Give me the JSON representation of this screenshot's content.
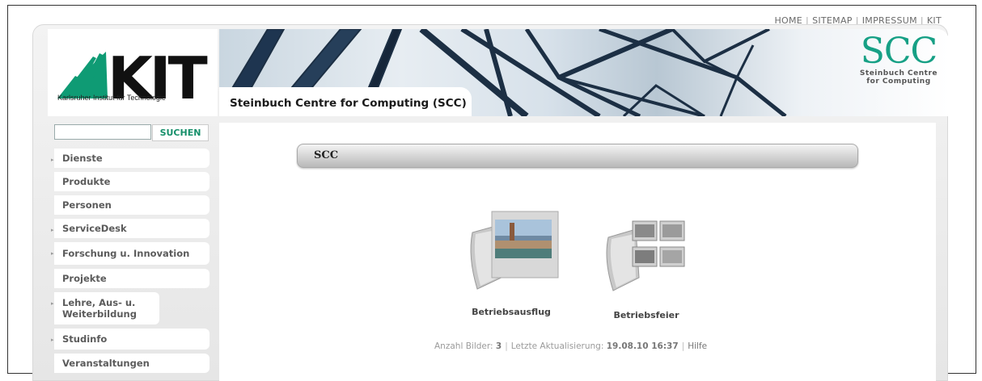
{
  "topnav": {
    "items": [
      "HOME",
      "SITEMAP",
      "IMPRESSUM",
      "KIT"
    ]
  },
  "header": {
    "kit_logo_text": "KIT",
    "kit_subtitle": "Karlsruher Institut für Technologie",
    "banner_title": "Steinbuch Centre for Computing (SCC)",
    "scc_logo_letters": "SCC",
    "scc_logo_line1": "Steinbuch Centre",
    "scc_logo_line2": "for Computing"
  },
  "search": {
    "value": "",
    "button_label": "SUCHEN"
  },
  "sidebar": {
    "items": [
      {
        "label": "Dienste",
        "arrow": true
      },
      {
        "label": "Produkte",
        "arrow": false
      },
      {
        "label": "Personen",
        "arrow": false
      },
      {
        "label": "ServiceDesk",
        "arrow": true
      },
      {
        "label": "Forschung u. Innovation",
        "arrow": true
      },
      {
        "label": "Projekte",
        "arrow": false
      },
      {
        "label": "Lehre, Aus- u. Weiterbildung",
        "arrow": true
      },
      {
        "label": "Studinfo",
        "arrow": true
      },
      {
        "label": "Veranstaltungen",
        "arrow": false
      }
    ]
  },
  "main": {
    "section_title": "SCC",
    "albums": [
      {
        "label": "Betriebsausflug"
      },
      {
        "label": "Betriebsfeier"
      }
    ],
    "footer": {
      "count_label": "Anzahl Bilder:",
      "count_value": "3",
      "updated_label": "Letzte Aktualisierung:",
      "updated_value": "19.08.10 16:37",
      "help_link": "Hilfe"
    }
  },
  "colors": {
    "kit_green": "#0f9b74",
    "scc_teal": "#16a085",
    "search_button_text": "#168f6a"
  }
}
